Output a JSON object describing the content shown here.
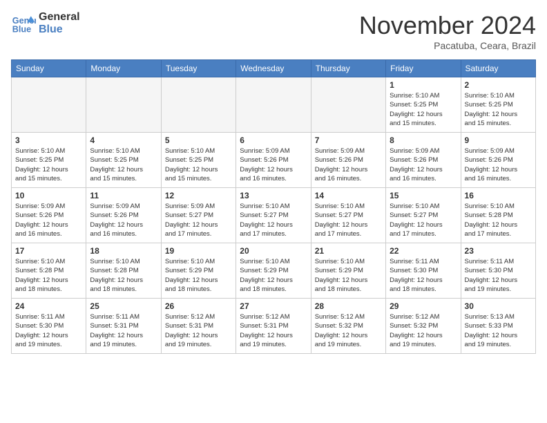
{
  "header": {
    "logo": {
      "line1": "General",
      "line2": "Blue"
    },
    "title": "November 2024",
    "location": "Pacatuba, Ceara, Brazil"
  },
  "days_of_week": [
    "Sunday",
    "Monday",
    "Tuesday",
    "Wednesday",
    "Thursday",
    "Friday",
    "Saturday"
  ],
  "weeks": [
    [
      {
        "day": "",
        "info": ""
      },
      {
        "day": "",
        "info": ""
      },
      {
        "day": "",
        "info": ""
      },
      {
        "day": "",
        "info": ""
      },
      {
        "day": "",
        "info": ""
      },
      {
        "day": "1",
        "info": "Sunrise: 5:10 AM\nSunset: 5:25 PM\nDaylight: 12 hours\nand 15 minutes."
      },
      {
        "day": "2",
        "info": "Sunrise: 5:10 AM\nSunset: 5:25 PM\nDaylight: 12 hours\nand 15 minutes."
      }
    ],
    [
      {
        "day": "3",
        "info": "Sunrise: 5:10 AM\nSunset: 5:25 PM\nDaylight: 12 hours\nand 15 minutes."
      },
      {
        "day": "4",
        "info": "Sunrise: 5:10 AM\nSunset: 5:25 PM\nDaylight: 12 hours\nand 15 minutes."
      },
      {
        "day": "5",
        "info": "Sunrise: 5:10 AM\nSunset: 5:25 PM\nDaylight: 12 hours\nand 15 minutes."
      },
      {
        "day": "6",
        "info": "Sunrise: 5:09 AM\nSunset: 5:26 PM\nDaylight: 12 hours\nand 16 minutes."
      },
      {
        "day": "7",
        "info": "Sunrise: 5:09 AM\nSunset: 5:26 PM\nDaylight: 12 hours\nand 16 minutes."
      },
      {
        "day": "8",
        "info": "Sunrise: 5:09 AM\nSunset: 5:26 PM\nDaylight: 12 hours\nand 16 minutes."
      },
      {
        "day": "9",
        "info": "Sunrise: 5:09 AM\nSunset: 5:26 PM\nDaylight: 12 hours\nand 16 minutes."
      }
    ],
    [
      {
        "day": "10",
        "info": "Sunrise: 5:09 AM\nSunset: 5:26 PM\nDaylight: 12 hours\nand 16 minutes."
      },
      {
        "day": "11",
        "info": "Sunrise: 5:09 AM\nSunset: 5:26 PM\nDaylight: 12 hours\nand 16 minutes."
      },
      {
        "day": "12",
        "info": "Sunrise: 5:09 AM\nSunset: 5:27 PM\nDaylight: 12 hours\nand 17 minutes."
      },
      {
        "day": "13",
        "info": "Sunrise: 5:10 AM\nSunset: 5:27 PM\nDaylight: 12 hours\nand 17 minutes."
      },
      {
        "day": "14",
        "info": "Sunrise: 5:10 AM\nSunset: 5:27 PM\nDaylight: 12 hours\nand 17 minutes."
      },
      {
        "day": "15",
        "info": "Sunrise: 5:10 AM\nSunset: 5:27 PM\nDaylight: 12 hours\nand 17 minutes."
      },
      {
        "day": "16",
        "info": "Sunrise: 5:10 AM\nSunset: 5:28 PM\nDaylight: 12 hours\nand 17 minutes."
      }
    ],
    [
      {
        "day": "17",
        "info": "Sunrise: 5:10 AM\nSunset: 5:28 PM\nDaylight: 12 hours\nand 18 minutes."
      },
      {
        "day": "18",
        "info": "Sunrise: 5:10 AM\nSunset: 5:28 PM\nDaylight: 12 hours\nand 18 minutes."
      },
      {
        "day": "19",
        "info": "Sunrise: 5:10 AM\nSunset: 5:29 PM\nDaylight: 12 hours\nand 18 minutes."
      },
      {
        "day": "20",
        "info": "Sunrise: 5:10 AM\nSunset: 5:29 PM\nDaylight: 12 hours\nand 18 minutes."
      },
      {
        "day": "21",
        "info": "Sunrise: 5:10 AM\nSunset: 5:29 PM\nDaylight: 12 hours\nand 18 minutes."
      },
      {
        "day": "22",
        "info": "Sunrise: 5:11 AM\nSunset: 5:30 PM\nDaylight: 12 hours\nand 18 minutes."
      },
      {
        "day": "23",
        "info": "Sunrise: 5:11 AM\nSunset: 5:30 PM\nDaylight: 12 hours\nand 19 minutes."
      }
    ],
    [
      {
        "day": "24",
        "info": "Sunrise: 5:11 AM\nSunset: 5:30 PM\nDaylight: 12 hours\nand 19 minutes."
      },
      {
        "day": "25",
        "info": "Sunrise: 5:11 AM\nSunset: 5:31 PM\nDaylight: 12 hours\nand 19 minutes."
      },
      {
        "day": "26",
        "info": "Sunrise: 5:12 AM\nSunset: 5:31 PM\nDaylight: 12 hours\nand 19 minutes."
      },
      {
        "day": "27",
        "info": "Sunrise: 5:12 AM\nSunset: 5:31 PM\nDaylight: 12 hours\nand 19 minutes."
      },
      {
        "day": "28",
        "info": "Sunrise: 5:12 AM\nSunset: 5:32 PM\nDaylight: 12 hours\nand 19 minutes."
      },
      {
        "day": "29",
        "info": "Sunrise: 5:12 AM\nSunset: 5:32 PM\nDaylight: 12 hours\nand 19 minutes."
      },
      {
        "day": "30",
        "info": "Sunrise: 5:13 AM\nSunset: 5:33 PM\nDaylight: 12 hours\nand 19 minutes."
      }
    ]
  ]
}
